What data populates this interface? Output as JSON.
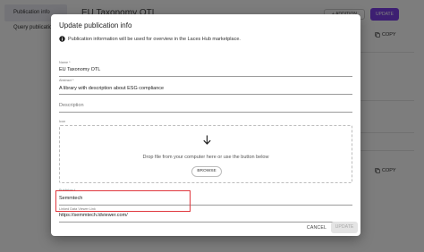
{
  "background": {
    "sidebar": {
      "tabs": [
        {
          "label": "Publication info"
        },
        {
          "label": "Query publication"
        }
      ]
    },
    "page_title": "EU Taxonomy OTL",
    "header_buttons": {
      "outline_label": "+ ADDITION",
      "update_label": "UPDATE"
    },
    "copy_buttons": [
      {
        "label": "COPY"
      },
      {
        "label": "COPY"
      }
    ]
  },
  "dialog": {
    "title": "Update publication info",
    "info_text": "Publication information will be used for overview in the Laces Hub marketplace.",
    "fields": {
      "name": {
        "label": "Name *",
        "value": "EU Taxonomy OTL"
      },
      "abstract": {
        "label": "Abstract *",
        "value": "A library with description about ESG compliance"
      },
      "description": {
        "placeholder": "Description"
      },
      "icon": {
        "label": "Icon"
      },
      "publisher": {
        "label": "Publisher *",
        "value": "Semmtech"
      },
      "linked_data_viewer_link": {
        "label": "Linked Data Viewer Link",
        "value": "https://semmtech.ldviewer.com/"
      }
    },
    "dropzone": {
      "text": "Drop file from your computer here or use the button below",
      "browse_label": "BROWSE"
    },
    "actions": {
      "cancel_label": "CANCEL",
      "update_label": "UPDATE"
    }
  },
  "colors": {
    "accent": "#7b3fe4",
    "highlight": "#e0383e"
  }
}
